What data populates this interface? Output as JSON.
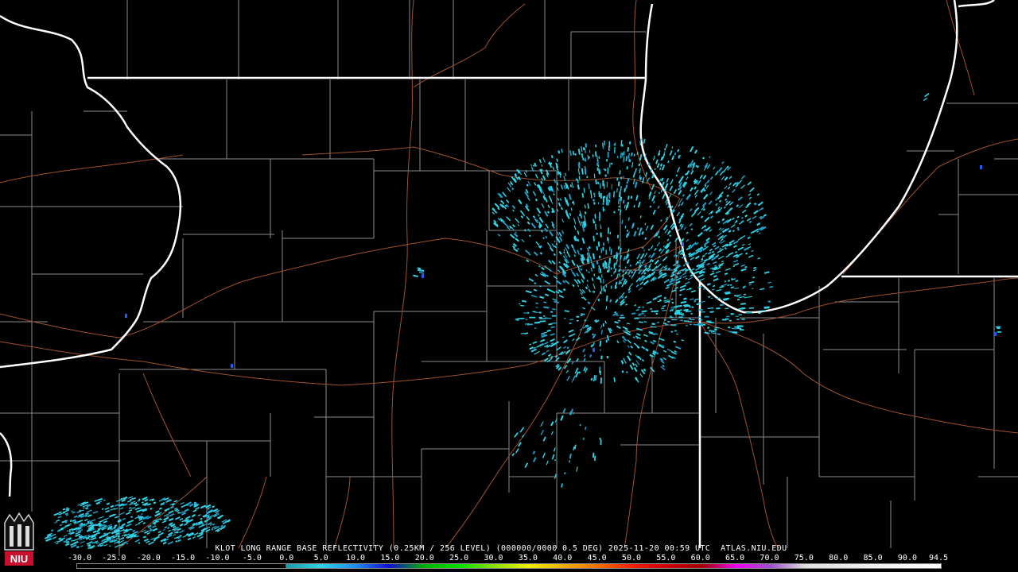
{
  "product": {
    "caption": "KLOT LONG RANGE BASE REFLECTIVITY (0.25KM / 256 LEVEL) (000000/0000 0.5 DEG) 2025-11-20 00:59 UTC  ATLAS.NIU.EDU",
    "station": "KLOT",
    "product_name": "LONG RANGE BASE REFLECTIVITY",
    "resolution": "0.25KM / 256 LEVEL",
    "elevation": "0.5 DEG",
    "valid_time": "2025-11-20 00:59 UTC",
    "source": "ATLAS.NIU.EDU"
  },
  "logo": {
    "text": "NIU",
    "color": "#c8102e"
  },
  "colorbar": {
    "tick_labels": [
      "-30.0",
      "-25.0",
      "-20.0",
      "-15.0",
      "-10.0",
      "-5.0",
      "0.0",
      "5.0",
      "10.0",
      "15.0",
      "20.0",
      "25.0",
      "30.0",
      "35.0",
      "40.0",
      "45.0",
      "50.0",
      "55.0",
      "60.0",
      "65.0",
      "70.0",
      "75.0",
      "80.0",
      "85.0",
      "90.0",
      "94.5"
    ],
    "min": -30.0,
    "max": 94.5,
    "stops": [
      {
        "dbz": -30,
        "color": "#000000"
      },
      {
        "dbz": 0,
        "color": "#000000"
      },
      {
        "dbz": 0.1,
        "color": "#1b9aa8"
      },
      {
        "dbz": 5,
        "color": "#2fd3e6"
      },
      {
        "dbz": 10,
        "color": "#1f8ff0"
      },
      {
        "dbz": 15,
        "color": "#1010d0"
      },
      {
        "dbz": 20,
        "color": "#00b000"
      },
      {
        "dbz": 25,
        "color": "#00e000"
      },
      {
        "dbz": 30,
        "color": "#88e000"
      },
      {
        "dbz": 35,
        "color": "#f0f000"
      },
      {
        "dbz": 40,
        "color": "#f0b000"
      },
      {
        "dbz": 45,
        "color": "#f07000"
      },
      {
        "dbz": 50,
        "color": "#f02000"
      },
      {
        "dbz": 55,
        "color": "#d00000"
      },
      {
        "dbz": 60,
        "color": "#a00000"
      },
      {
        "dbz": 65,
        "color": "#f000f0"
      },
      {
        "dbz": 70,
        "color": "#a050d0"
      },
      {
        "dbz": 75,
        "color": "#e0e0e0"
      },
      {
        "dbz": 94.5,
        "color": "#ffffff"
      }
    ]
  },
  "map_colors": {
    "background": "#000000",
    "state_borders": "#ffffff",
    "county_lines": "#8c8c8c",
    "highways": "#a0522d",
    "echo_light": "#2fd3e6",
    "echo_mid": "#1f9fc8",
    "echo_strong": "#1f5ff0"
  }
}
